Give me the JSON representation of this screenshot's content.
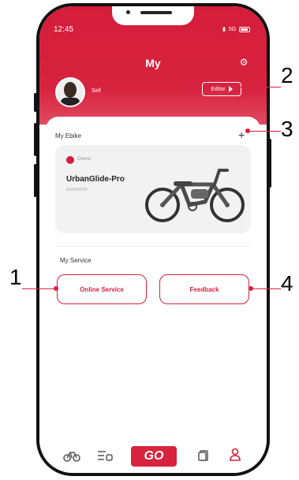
{
  "status": {
    "time": "12:45",
    "network": "5G"
  },
  "header": {
    "title": "My"
  },
  "user": {
    "name": "Sell",
    "editor_label": "Editor"
  },
  "ebike": {
    "section_label": "My Ebike",
    "add_symbol": "+",
    "badge": "Owner",
    "model": "UrbanGlide-Pro",
    "serial": "XDA000008"
  },
  "service": {
    "section_label": "My Service",
    "online_label": "Online Service",
    "feedback_label": "Feedback"
  },
  "tabbar": {
    "go_label": "GO"
  },
  "callouts": {
    "c1": "1",
    "c2": "2",
    "c3": "3",
    "c4": "4"
  },
  "colors": {
    "brand": "#d8233f"
  }
}
